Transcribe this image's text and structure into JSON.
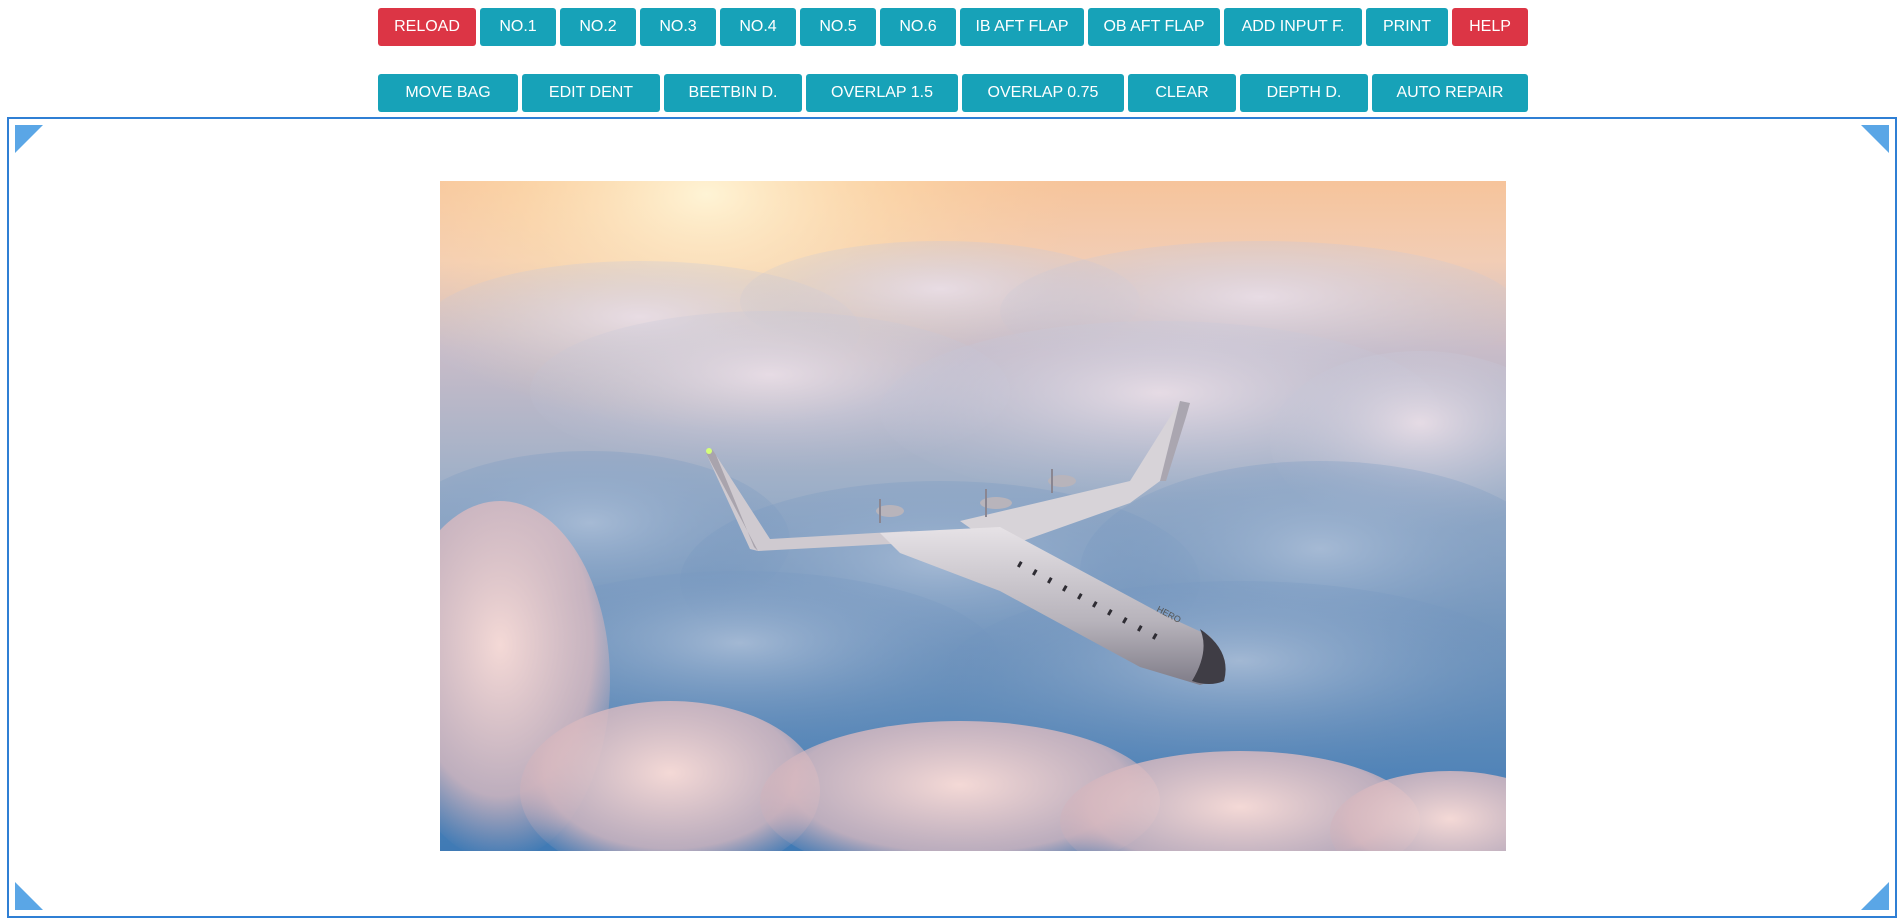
{
  "toolbar_row1": {
    "reload": "RELOAD",
    "no1": "NO.1",
    "no2": "NO.2",
    "no3": "NO.3",
    "no4": "NO.4",
    "no5": "NO.5",
    "no6": "NO.6",
    "ib_aft_flap": "IB AFT FLAP",
    "ob_aft_flap": "OB AFT FLAP",
    "add_input": "ADD INPUT F.",
    "print": "PRINT",
    "help": "HELP"
  },
  "toolbar_row2": {
    "move_bag": "MOVE BAG",
    "edit_dent": "EDIT DENT",
    "beetbin": "BEETBIN D.",
    "overlap_15": "OVERLAP 1.5",
    "overlap_075": "OVERLAP 0.75",
    "clear": "CLEAR",
    "depth": "DEPTH D.",
    "auto_repair": "AUTO REPAIR"
  },
  "viewer": {
    "image_subject": "aircraft flying above clouds at sunset",
    "aircraft_marking": "HERO"
  },
  "colors": {
    "primary_button": "#17a2b8",
    "danger_button": "#dc3545",
    "viewer_border": "#2f7fd4",
    "corner_handle": "#5aa6e6"
  }
}
